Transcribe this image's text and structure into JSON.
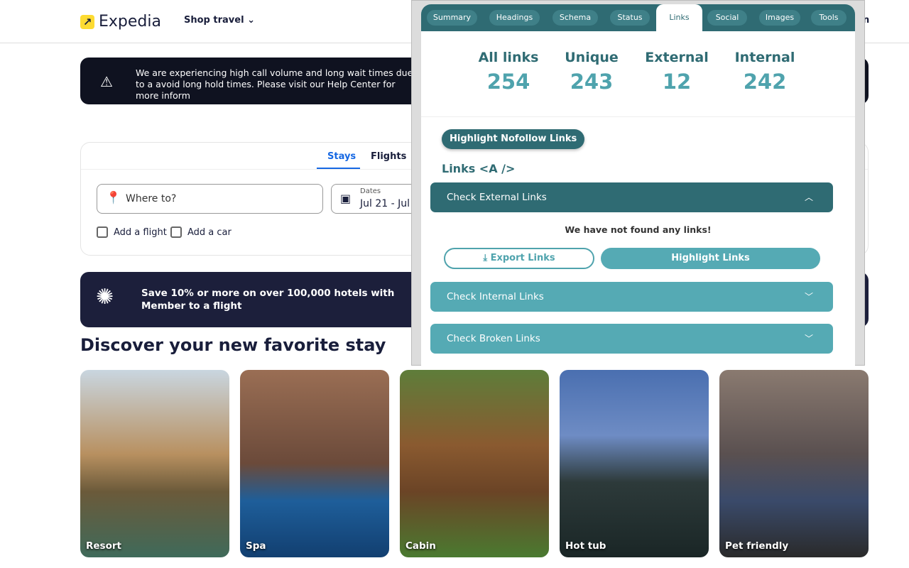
{
  "header": {
    "logo_text": "Expedia",
    "shop_travel": "Shop travel",
    "sign_in_partial": "n"
  },
  "alert": {
    "text": "We are experiencing high call volume and long wait times due to a avoid long hold times. Please visit our Help Center for more inform"
  },
  "search": {
    "tabs": [
      "Stays",
      "Flights"
    ],
    "active_tab": "Stays",
    "where_placeholder": "Where to?",
    "dates_label": "Dates",
    "dates_value": "Jul 21 - Jul",
    "add_flight": "Add a flight",
    "add_car": "Add a car"
  },
  "promo": {
    "text": "Save 10% or more on over 100,000 hotels with Member to a flight"
  },
  "discover": {
    "title": "Discover your new favorite stay",
    "cards": [
      "Resort",
      "Spa",
      "Cabin",
      "Hot tub",
      "Pet friendly"
    ]
  },
  "extension": {
    "tabs": [
      "Summary",
      "Headings",
      "Schema",
      "Status",
      "Links",
      "Social",
      "Images",
      "Tools"
    ],
    "active_tab": "Links",
    "stats": [
      {
        "label": "All links",
        "value": "254"
      },
      {
        "label": "Unique",
        "value": "243"
      },
      {
        "label": "External",
        "value": "12"
      },
      {
        "label": "Internal",
        "value": "242"
      }
    ],
    "nofollow_button": "Highlight Nofollow Links",
    "section_title": "Links <A />",
    "accordions": [
      {
        "label": "Check External Links",
        "expanded": true
      },
      {
        "label": "Check Internal Links",
        "expanded": false
      },
      {
        "label": "Check Broken Links",
        "expanded": false
      }
    ],
    "not_found": "We have not found any links!",
    "export_button": "Export Links",
    "highlight_button": "Highlight Links",
    "colors": {
      "dark_teal": "#2f6b73",
      "teal": "#55aab4"
    }
  }
}
